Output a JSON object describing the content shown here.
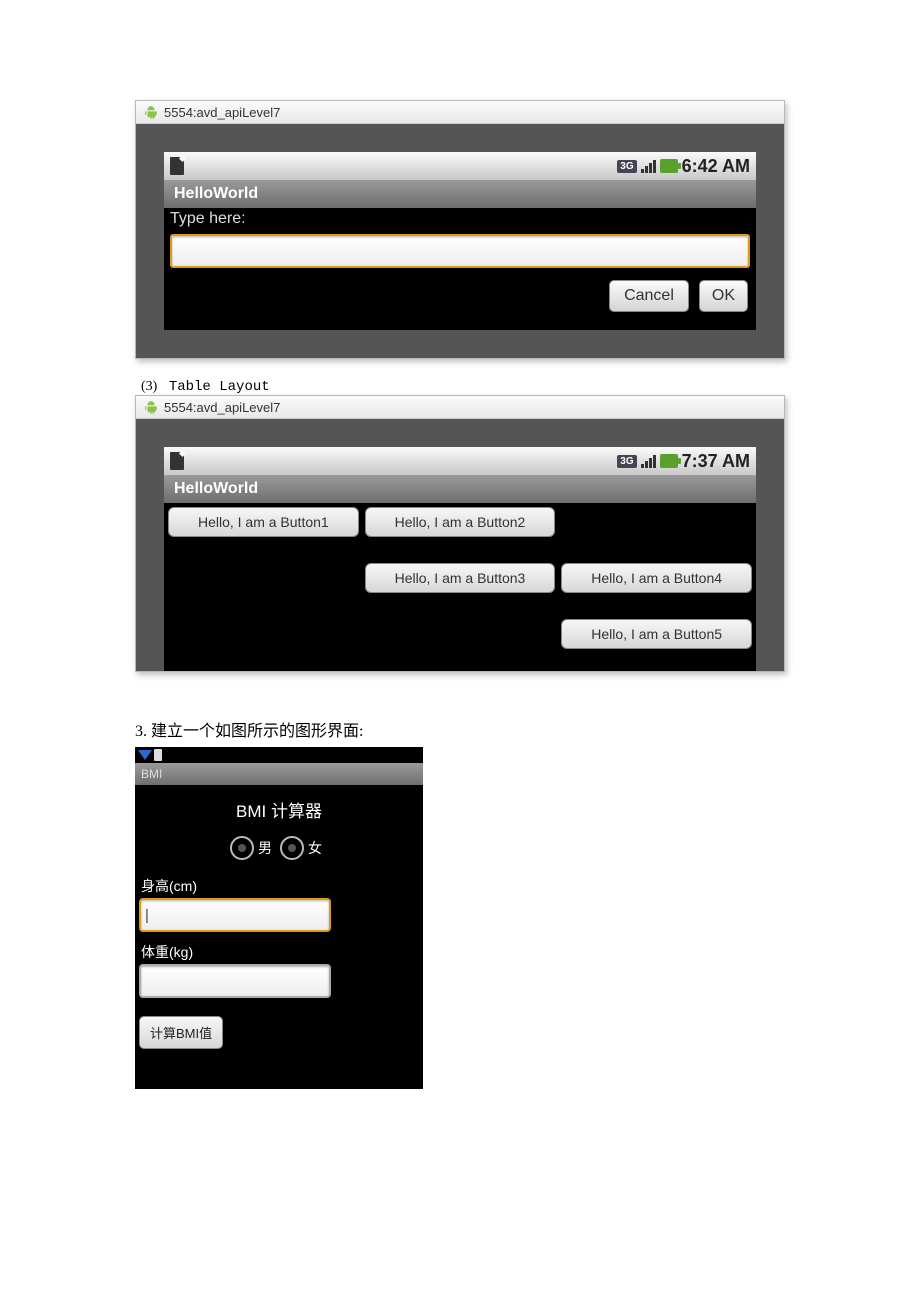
{
  "emu1": {
    "title": "5554:avd_apiLevel7",
    "clock": "6:42 AM",
    "status_3g": "3G",
    "app_name": "HelloWorld",
    "prompt": "Type here:",
    "input_value": "",
    "btn_cancel": "Cancel",
    "btn_ok": "OK"
  },
  "section2": {
    "number": "(3)",
    "title": "Table Layout"
  },
  "emu2": {
    "title": "5554:avd_apiLevel7",
    "clock": "7:37 AM",
    "status_3g": "3G",
    "app_name": "HelloWorld",
    "buttons": {
      "b1": "Hello, I am a Button1",
      "b2": "Hello, I am a Button2",
      "b3": "Hello, I am a Button3",
      "b4": "Hello, I am a Button4",
      "b5": "Hello, I am a Button5"
    }
  },
  "exercise": {
    "heading": "3. 建立一个如图所示的图形界面:"
  },
  "bmi": {
    "app_bar": "BMI",
    "title": "BMI 计算器",
    "radio_male": "男",
    "radio_female": "女",
    "height_label": "身高(cm)",
    "height_value": "|",
    "weight_label": "体重(kg)",
    "weight_value": "",
    "calc_button": "计算BMI值"
  }
}
